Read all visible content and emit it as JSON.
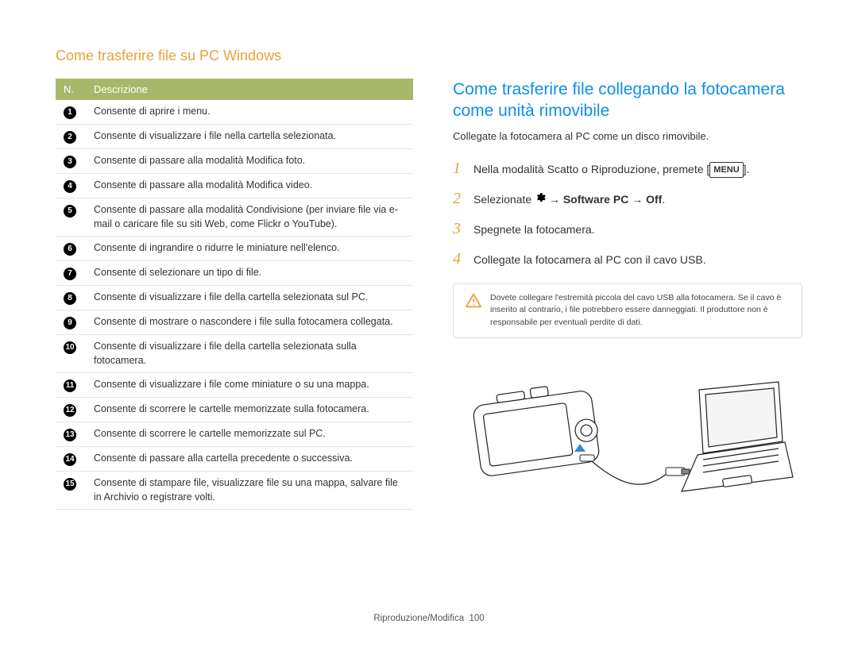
{
  "header": "Come trasferire file su PC Windows",
  "table": {
    "head_n": "N.",
    "head_desc": "Descrizione",
    "rows": [
      {
        "n": "1",
        "desc": "Consente di aprire i menu."
      },
      {
        "n": "2",
        "desc": "Consente di visualizzare i file nella cartella selezionata."
      },
      {
        "n": "3",
        "desc": "Consente di passare alla modalità Modifica foto."
      },
      {
        "n": "4",
        "desc": "Consente di passare alla modalità Modifica video."
      },
      {
        "n": "5",
        "desc": "Consente di passare alla modalità Condivisione (per inviare file via e-mail o caricare file su siti Web, come Flickr o YouTube)."
      },
      {
        "n": "6",
        "desc": "Consente di ingrandire o ridurre le miniature nell'elenco."
      },
      {
        "n": "7",
        "desc": "Consente di selezionare un tipo di file."
      },
      {
        "n": "8",
        "desc": "Consente di visualizzare i file della cartella selezionata sul PC."
      },
      {
        "n": "9",
        "desc": "Consente di mostrare o nascondere i file sulla fotocamera collegata."
      },
      {
        "n": "10",
        "desc": "Consente di visualizzare i file della cartella selezionata sulla fotocamera."
      },
      {
        "n": "11",
        "desc": "Consente di visualizzare i file come miniature o su una mappa."
      },
      {
        "n": "12",
        "desc": "Consente di scorrere le cartelle memorizzate sulla fotocamera."
      },
      {
        "n": "13",
        "desc": "Consente di scorrere le cartelle memorizzate sul PC."
      },
      {
        "n": "14",
        "desc": "Consente di passare alla cartella precedente o successiva."
      },
      {
        "n": "15",
        "desc": "Consente di stampare file, visualizzare file su una mappa, salvare file in Archivio o registrare volti."
      }
    ]
  },
  "right": {
    "title": "Come trasferire file collegando la fotocamera come unità rimovibile",
    "intro": "Collegate la fotocamera al PC come un disco rimovibile.",
    "step1_pre": "Nella modalità Scatto o Riproduzione, premete [",
    "step1_btn": "MENU",
    "step1_post": "].",
    "step2_pre": "Selezionate ",
    "step2_arrow1": " → ",
    "step2_bold1": "Software PC",
    "step2_arrow2": " → ",
    "step2_bold2": "Off",
    "step2_post": ".",
    "step3": "Spegnete la fotocamera.",
    "step4": "Collegate la fotocamera al PC con il cavo USB.",
    "nums": {
      "n1": "1",
      "n2": "2",
      "n3": "3",
      "n4": "4"
    },
    "warning": "Dovete collegare l'estremità piccola del cavo USB alla fotocamera. Se il cavo è inserito al contrario, i file potrebbero essere danneggiati. Il produttore non è responsabile per eventuali perdite di dati."
  },
  "footer": {
    "section": "Riproduzione/Modifica",
    "page": "100"
  }
}
